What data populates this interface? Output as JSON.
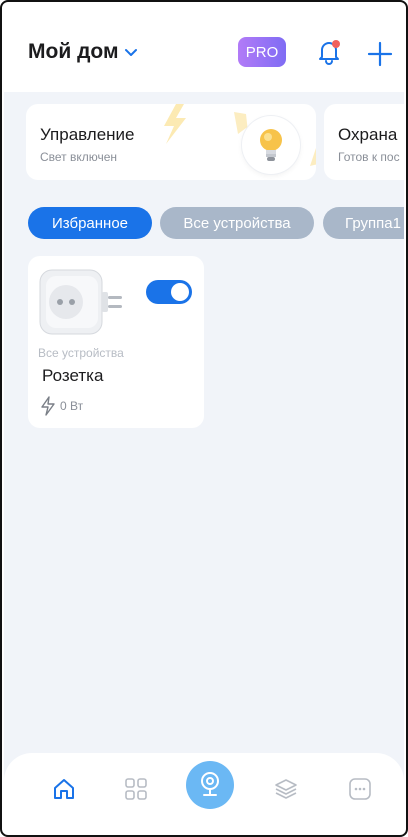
{
  "header": {
    "home_name": "Мой дом",
    "pro_label": "PRO"
  },
  "scenes": [
    {
      "title": "Управление",
      "subtitle": "Свет включен"
    },
    {
      "title": "Охрана",
      "subtitle": "Готов к пос"
    }
  ],
  "chips": [
    {
      "label": "Избранное",
      "active": true
    },
    {
      "label": "Все устройства",
      "active": false
    },
    {
      "label": "Группа1",
      "active": false
    }
  ],
  "device": {
    "group": "Все устройства",
    "name": "Розетка",
    "power": "0 Вт",
    "on": true
  },
  "nav": {
    "items": [
      "home-icon",
      "grid-icon",
      "camera-icon",
      "layers-icon",
      "more-icon"
    ],
    "active": "home-icon"
  },
  "colors": {
    "accent": "#1a73e8",
    "chip_inactive": "#a9b7c9",
    "pro_gradient_start": "#b27bf7",
    "pro_gradient_end": "#7f6cf4",
    "background": "#f1f4f9"
  }
}
